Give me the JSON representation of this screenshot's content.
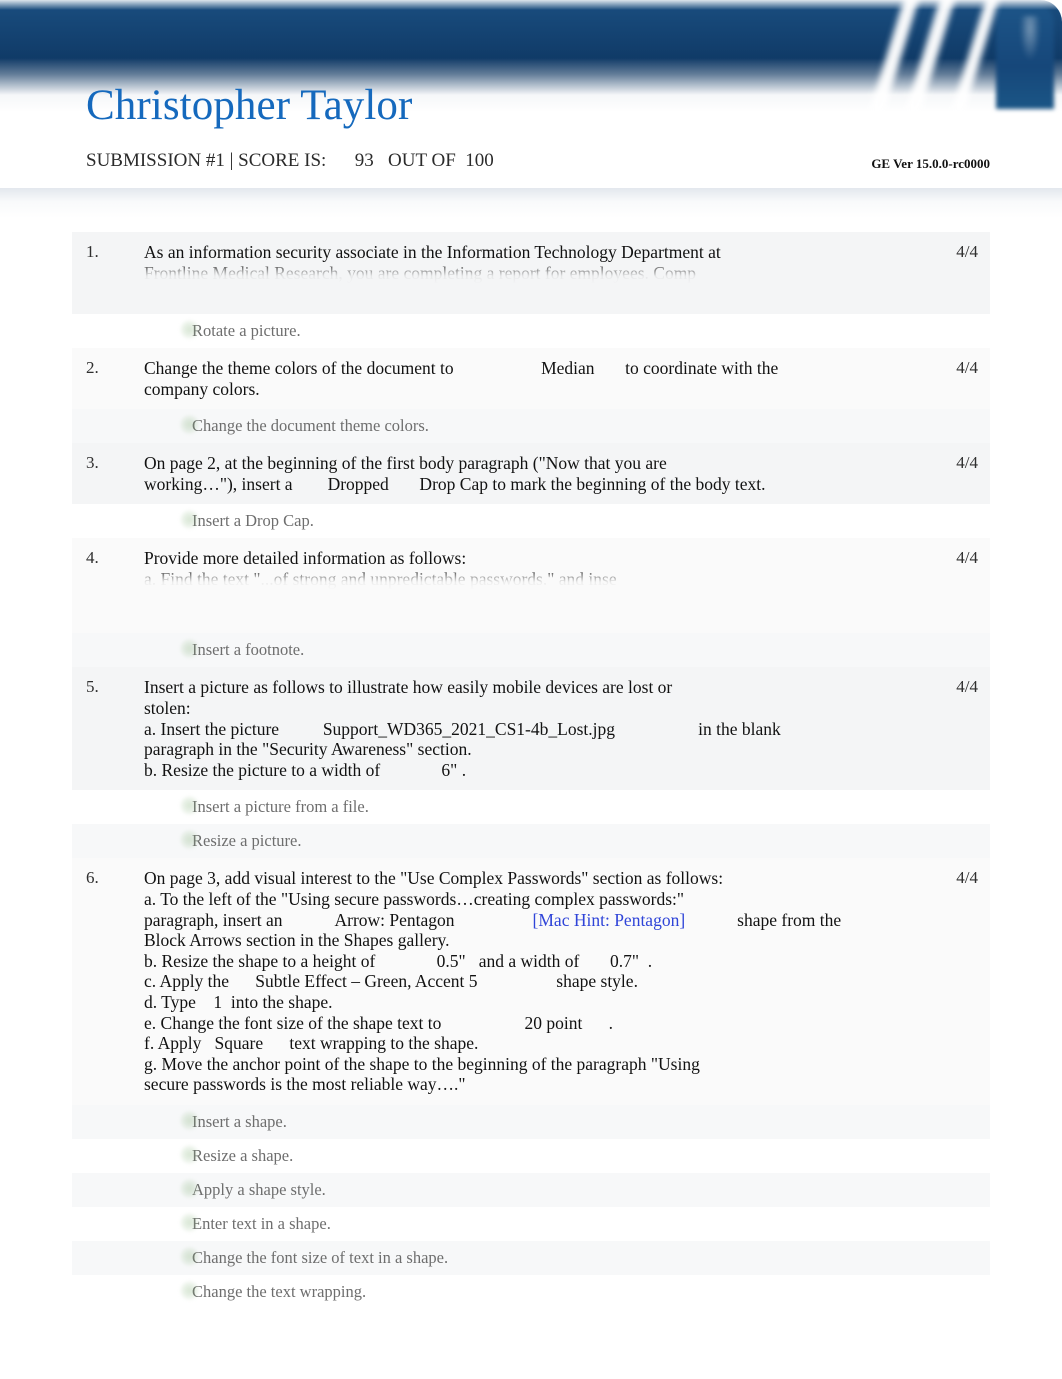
{
  "header": {
    "student_name": "Christopher Taylor",
    "submission_label": "SUBMISSION #1 | SCORE IS:",
    "score": "93",
    "out_of_label": "OUT OF",
    "total": "100",
    "submission_line": "SUBMISSION #1 | SCORE IS:      93   OUT OF  100",
    "version": "GE Ver 15.0.0-rc0000",
    "banner_color": "#0d3560",
    "name_color": "#1569bd"
  },
  "questions": [
    {
      "number": "1.",
      "score": "4/4",
      "text": "As an information security associate in the Information Technology Department at\nFrontline Medical Research, you are completing a report for employees. Comp",
      "clipped": true,
      "steps": [
        {
          "label": "Rotate a picture."
        }
      ]
    },
    {
      "number": "2.",
      "score": "4/4",
      "text_parts": [
        "Change the theme colors of the document to",
        "Median",
        "to coordinate with the\ncompany colors."
      ],
      "text": "Change the theme colors of the document to                    Median       to coordinate with the\ncompany colors.",
      "clipped": false,
      "steps": [
        {
          "label": "Change the document theme colors."
        }
      ]
    },
    {
      "number": "3.",
      "score": "4/4",
      "text": "On page 2, at the beginning of the first body paragraph (\"Now that you are\nworking…\"), insert a        Dropped       Drop Cap to mark the beginning of the body text.",
      "clipped": false,
      "steps": [
        {
          "label": "Insert a Drop Cap."
        }
      ]
    },
    {
      "number": "4.",
      "score": "4/4",
      "text": "Provide more detailed information as follows:\na. Find the text \"...of strong and unpredictable passwords.\" and inse",
      "clipped": true,
      "steps": [
        {
          "label": "Insert a footnote."
        }
      ]
    },
    {
      "number": "5.",
      "score": "4/4",
      "text": "Insert a picture as follows to illustrate how easily mobile devices are lost or\nstolen:\na. Insert the picture          Support_WD365_2021_CS1-4b_Lost.jpg                   in the blank\nparagraph in the \"Security Awareness\" section.\nb. Resize the picture to a width of              6\" .",
      "clipped": false,
      "steps": [
        {
          "label": "Insert a picture from a file."
        },
        {
          "label": "Resize a picture."
        }
      ]
    },
    {
      "number": "6.",
      "score": "4/4",
      "text_line1": "On page 3, add visual interest to the \"Use Complex Passwords\" section as follows:",
      "text_line2": "a. To the left of the \"Using secure passwords…creating complex passwords:\"",
      "text_line3a": "paragraph, insert an",
      "text_line3b": "Arrow: Pentagon",
      "text_line3c": "[Mac Hint: Pentagon]",
      "text_line3d": "shape from the",
      "text_line4": "Block Arrows section in the Shapes gallery.",
      "text_line5": "b. Resize the shape to a height of              0.5\"   and a width of       0.7\"  .",
      "text_line6": "c. Apply the      Subtle Effect – Green, Accent 5                  shape style.",
      "text_line7": "d. Type    1  into the shape.",
      "text_line8": "e. Change the font size of the shape text to                   20 point      .",
      "text_line9": "f. Apply   Square      text wrapping to the shape.",
      "text_line10": "g. Move the anchor point of the shape to the beginning of the paragraph \"Using",
      "text_line11": "secure passwords is the most reliable way….\"",
      "clipped": false,
      "steps": [
        {
          "label": "Insert a shape."
        },
        {
          "label": "Resize a shape."
        },
        {
          "label": "Apply a shape style."
        },
        {
          "label": "Enter text in a shape."
        },
        {
          "label": "Change the font size of text in a shape."
        },
        {
          "label": "Change the text wrapping."
        }
      ]
    }
  ]
}
